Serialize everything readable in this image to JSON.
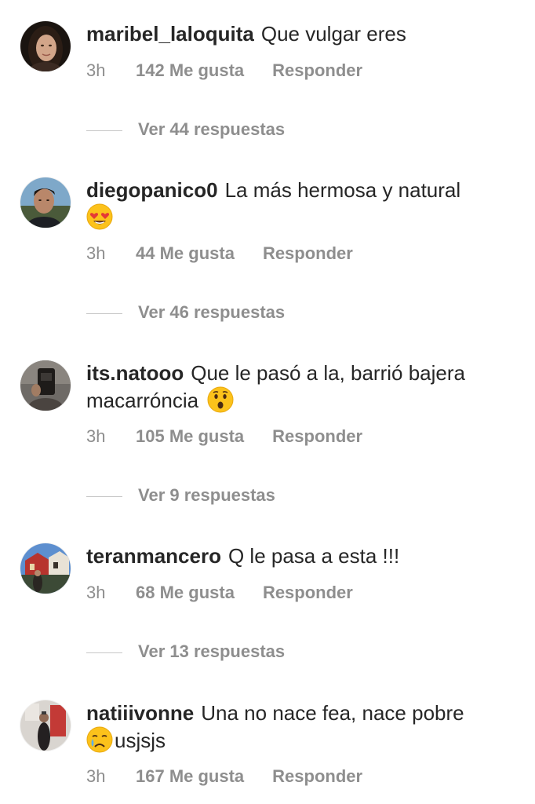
{
  "comments": [
    {
      "username": "maribel_laloquita",
      "text": "Que vulgar eres",
      "time": "3h",
      "likes": "142 Me gusta",
      "reply": "Responder",
      "view_replies": "Ver 44 respuestas"
    },
    {
      "username": "diegopanico0",
      "text": "La más hermosa y natural",
      "emoji": "heart-eyes-emoji",
      "time": "3h",
      "likes": "44 Me gusta",
      "reply": "Responder",
      "view_replies": "Ver 46 respuestas"
    },
    {
      "username": "its.natooo",
      "text": "Que le pasó a la, barrió bajera macarróncia",
      "emoji": "surprised-face-emoji",
      "time": "3h",
      "likes": "105 Me gusta",
      "reply": "Responder",
      "view_replies": "Ver 9 respuestas"
    },
    {
      "username": "teranmancero",
      "text": "Q le pasa a esta !!!",
      "time": "3h",
      "likes": "68 Me gusta",
      "reply": "Responder",
      "view_replies": "Ver 13 respuestas"
    },
    {
      "username": "natiiivonne",
      "text": "Una no nace fea, nace pobre",
      "emoji": "crying-face-emoji",
      "text_after_emoji": "usjsjs",
      "time": "3h",
      "likes": "167 Me gusta",
      "reply": "Responder"
    }
  ],
  "colors": {
    "text": "#262626",
    "secondary": "#8e8e8e",
    "divider": "#c7c7c7",
    "emoji_yellow": "#fcc21b"
  }
}
